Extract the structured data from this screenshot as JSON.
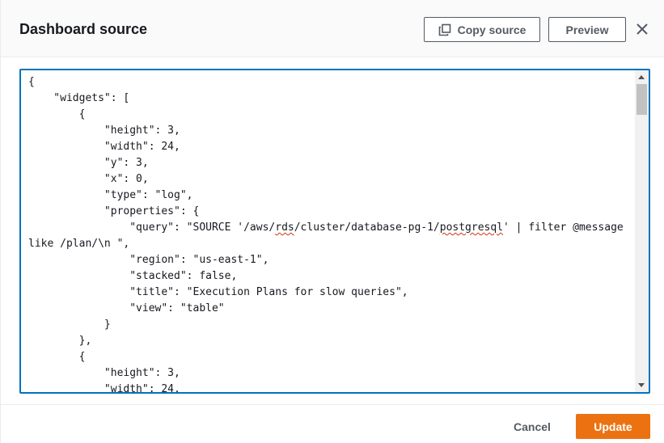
{
  "modal": {
    "title": "Dashboard source",
    "copy_source_label": "Copy source",
    "preview_label": "Preview",
    "close_icon": "close-icon",
    "copy_icon": "copy-icon"
  },
  "editor": {
    "lines": [
      "{",
      "    \"widgets\": [",
      "        {",
      "            \"height\": 3,",
      "            \"width\": 24,",
      "            \"y\": 3,",
      "            \"x\": 0,",
      "            \"type\": \"log\",",
      "            \"properties\": {",
      "                \"query\": \"SOURCE '/aws/rds/cluster/database-pg-1/postgresql' | filter @message",
      "like /plan/\\n \",",
      "                \"region\": \"us-east-1\",",
      "                \"stacked\": false,",
      "                \"title\": \"Execution Plans for slow queries\",",
      "                \"view\": \"table\"",
      "            }",
      "        },",
      "        {",
      "            \"height\": 3,",
      "            \"width\": 24,"
    ],
    "spellcheck_words": [
      "rds",
      "postgresql"
    ]
  },
  "footer": {
    "cancel_label": "Cancel",
    "update_label": "Update"
  },
  "colors": {
    "accent": "#0073bb",
    "primary_button": "#ec7211",
    "text": "#16191f",
    "secondary_text": "#545b64",
    "spellcheck": "#d13212"
  }
}
